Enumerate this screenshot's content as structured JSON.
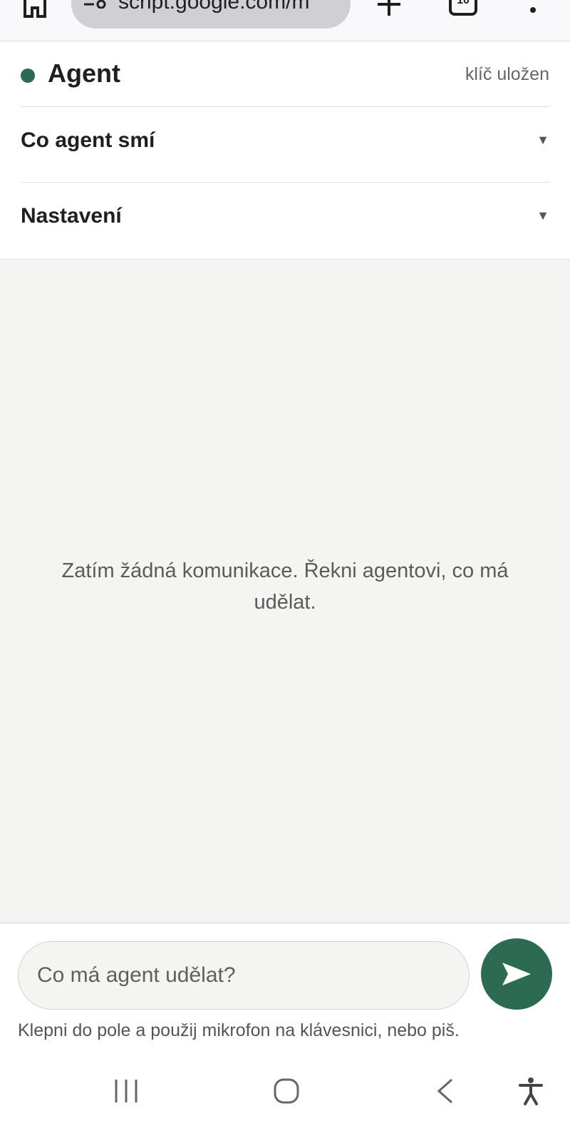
{
  "browser": {
    "url": "script.google.com/m",
    "tab_count": "10"
  },
  "header": {
    "title": "Agent",
    "status_color": "#2d6a52",
    "key_status": "klíč uložen"
  },
  "sections": [
    {
      "label": "Co agent smí",
      "caret": "▼"
    },
    {
      "label": "Nastavení",
      "caret": "▼"
    }
  ],
  "chat": {
    "empty_message": "Zatím žádná komunikace. Řekni agentovi, co má udělat."
  },
  "composer": {
    "placeholder": "Co má agent udělat?",
    "hint": "Klepni do pole a použij mikrofon na klávesnici, nebo piš.",
    "send_icon": "send-icon",
    "accent": "#2d6a52"
  },
  "nav": {
    "icons": [
      "recent-apps-icon",
      "home-icon",
      "back-icon",
      "accessibility-icon"
    ]
  }
}
